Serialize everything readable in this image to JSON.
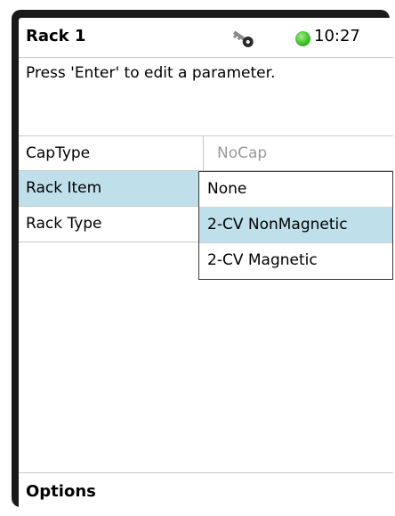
{
  "header": {
    "title": "Rack 1",
    "icon": "key-icon",
    "status_color": "#3fbf2a",
    "time": "10:27"
  },
  "message": "Press 'Enter' to edit a parameter.",
  "parameters": [
    {
      "label": "CapType",
      "value": "NoCap"
    },
    {
      "label": "Rack Item",
      "value": ""
    },
    {
      "label": "Rack Type",
      "value": ""
    }
  ],
  "dropdown": {
    "options": [
      "None",
      "2-CV NonMagnetic",
      "2-CV Magnetic"
    ],
    "selected": "2-CV NonMagnetic"
  },
  "footer": {
    "options_label": "Options"
  },
  "colors": {
    "highlight": "#bfe0ea",
    "bezel": "#1a1a1a"
  }
}
